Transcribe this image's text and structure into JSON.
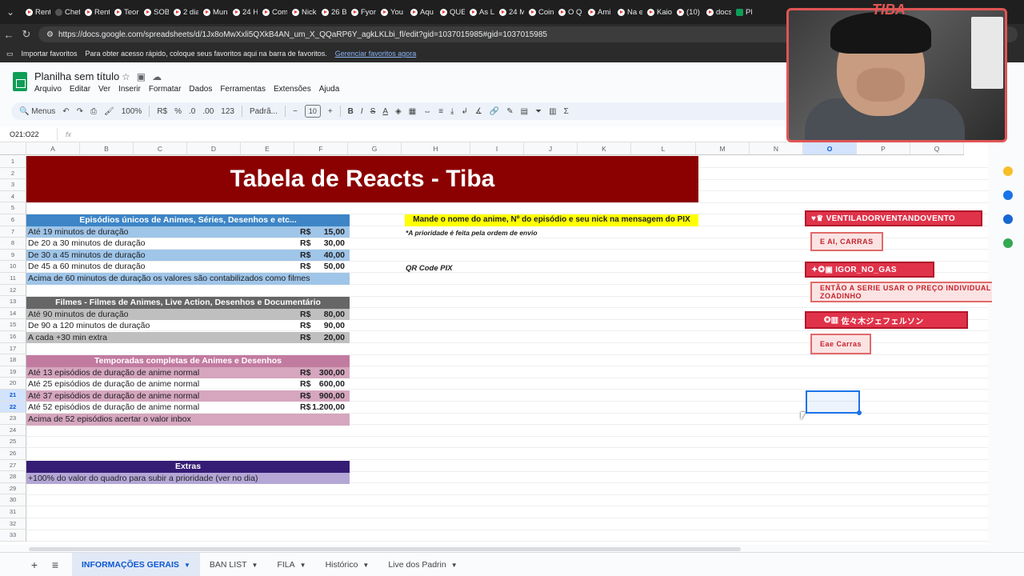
{
  "browser": {
    "tabs": [
      "Rent",
      "Chef",
      "Rent",
      "Teor",
      "SOBI",
      "2 dia",
      "Mun",
      "24 H",
      "Com",
      "Nick",
      "26 B",
      "Fyor",
      "You",
      "Aqu",
      "QUE",
      "As L",
      "24 M",
      "Coin",
      "O Q",
      "Ami",
      "Na e",
      "Kaio",
      "(10)",
      "docs",
      "Pl"
    ],
    "url": "https://docs.google.com/spreadsheets/d/1Jx8oMwXxli5QXkB4AN_um_X_QQaRP6Y_agkLKLbi_fl/edit?gid=1037015985#gid=1037015985",
    "bookmarks": {
      "import": "Importar favoritos",
      "hint": "Para obter acesso rápido, coloque seus favoritos aqui na barra de favoritos.",
      "manage": "Gerenciar favoritos agora"
    }
  },
  "sheet": {
    "title": "Planilha sem título",
    "menus": [
      "Arquivo",
      "Editar",
      "Ver",
      "Inserir",
      "Formatar",
      "Dados",
      "Ferramentas",
      "Extensões",
      "Ajuda"
    ],
    "toolbar": {
      "menus": "Menus",
      "zoom": "100%",
      "currency": "R$",
      "percent": "%",
      "dec_less": ".0",
      "dec_more": ".00",
      "numfmt": "123",
      "font": "Padrã...",
      "font_size": "10"
    },
    "namebox": "O21:O22",
    "fx": "fx",
    "columns": [
      "A",
      "B",
      "C",
      "D",
      "E",
      "F",
      "G",
      "H",
      "I",
      "J",
      "K",
      "L",
      "M",
      "N",
      "O",
      "P",
      "Q"
    ],
    "rows": [
      "1",
      "2",
      "3",
      "4",
      "5",
      "6",
      "7",
      "8",
      "9",
      "10",
      "11",
      "12",
      "13",
      "14",
      "15",
      "16",
      "17",
      "18",
      "19",
      "20",
      "21",
      "22",
      "23",
      "24",
      "25",
      "26",
      "27",
      "28",
      "29",
      "30",
      "31",
      "32",
      "33"
    ]
  },
  "content": {
    "banner": "Tabela de Reacts - Tiba",
    "sec1": {
      "title": "Episódios únicos de Animes, Séries, Desenhos e etc...",
      "rows": [
        {
          "label": "Até 19 minutos de duração",
          "cur": "R$",
          "price": "15,00"
        },
        {
          "label": "De 20 a 30 minutos de duração",
          "cur": "R$",
          "price": "30,00"
        },
        {
          "label": "De 30 a 45 minutos de duração",
          "cur": "R$",
          "price": "40,00"
        },
        {
          "label": "De 45 a 60 minutos de duração",
          "cur": "R$",
          "price": "50,00"
        }
      ],
      "footer": "Acima de 60 minutos de duração os valores são contabilizados como filmes"
    },
    "sec2": {
      "title": "Filmes - Filmes de Animes, Live Action, Desenhos e Documentário",
      "rows": [
        {
          "label": "Até 90 minutos de duração",
          "cur": "R$",
          "price": "80,00"
        },
        {
          "label": "De 90 a 120 minutos de duração",
          "cur": "R$",
          "price": "90,00"
        },
        {
          "label": "A cada +30 min extra",
          "cur": "R$",
          "price": "20,00"
        }
      ]
    },
    "sec3": {
      "title": "Temporadas completas de Animes e Desenhos",
      "rows": [
        {
          "label": "Até 13 episódios de duração de anime normal",
          "cur": "R$",
          "price": "300,00"
        },
        {
          "label": "Até 25 episódios de duração de anime normal",
          "cur": "R$",
          "price": "600,00"
        },
        {
          "label": "Até 37 episódios de duração de anime normal",
          "cur": "R$",
          "price": "900,00"
        },
        {
          "label": "Até 52 episódios de duração de anime normal",
          "cur": "R$",
          "price": "1.200,00"
        }
      ],
      "footer": "Acima de 52 episódios acertar o valor inbox"
    },
    "sec4": {
      "title": "Extras",
      "footer": "+100% do valor do quadro para subir a prioridade (ver no dia)"
    },
    "pix_note": "Mande o nome do anime, Nº do episódio e seu nick na mensagem do PIX",
    "priority_note": "*A prioridade é feita pela ordem de envio",
    "qr": "QR Code PIX"
  },
  "chat": [
    {
      "name": "VENTILADORVENTANDOVENTO",
      "msg": "E AI, CARRAS"
    },
    {
      "name": "IGOR_NO_GAS",
      "msg": "ENTÃO A SERIE USAR O PREÇO INDIVIDUAL É ZOADINHO"
    },
    {
      "name": "佐々木ジェフェルソン",
      "msg": "Eae Carras"
    }
  ],
  "webcam": {
    "overlay": "TIBA"
  },
  "sheet_tabs": [
    "INFORMAÇÕES GERAIS",
    "BAN LIST",
    "FILA",
    "Histórico",
    "Live dos Padrin"
  ]
}
